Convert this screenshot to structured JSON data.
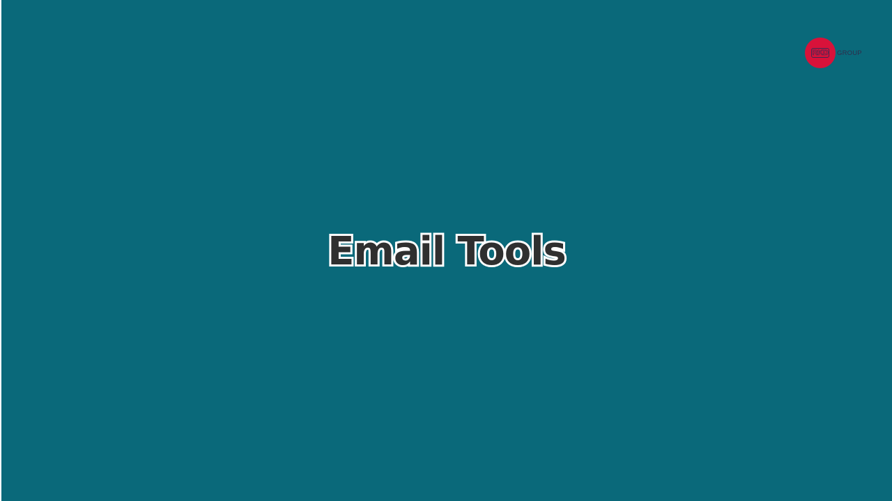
{
  "slide": {
    "background_color": "#0a697a",
    "title": "Email Tools",
    "title_fill_color": "#2f2f2f",
    "title_outline_color": "#ffffff"
  },
  "logo": {
    "mark": "RKD",
    "word": "GROUP",
    "circle_color": "#d8123a"
  }
}
